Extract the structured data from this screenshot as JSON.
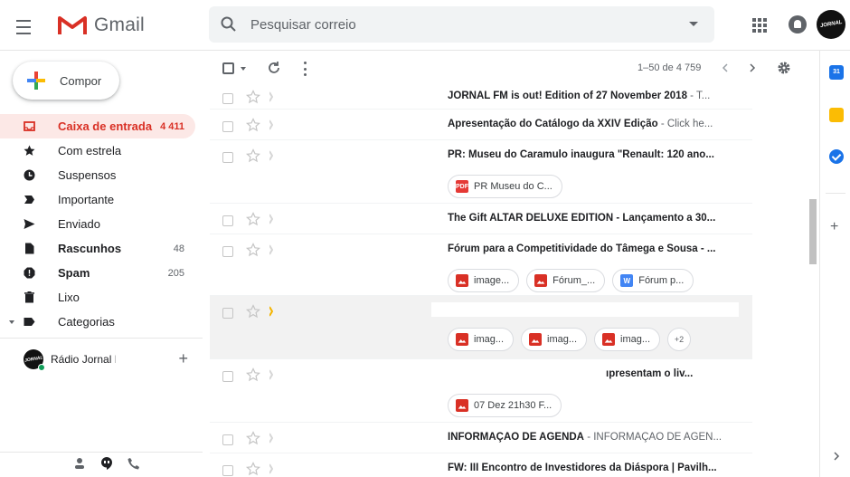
{
  "app": {
    "name": "Gmail",
    "colors": {
      "accent": "#d93025",
      "active_bg": "#fce8e6",
      "search_bg": "#f1f3f4",
      "selected_row": "#f2f2f2"
    }
  },
  "header": {
    "search_placeholder": "Pesquisar correio",
    "icons": [
      "menu-icon",
      "gmail-logo",
      "search-icon",
      "apps-grid-icon",
      "notifications-icon",
      "account-avatar"
    ],
    "avatar_text": "JORNAL"
  },
  "sidebar": {
    "compose_label": "Compor",
    "items": [
      {
        "label": "Caixa de entrada",
        "count": "4 411",
        "icon": "inbox-icon",
        "active": true,
        "bold": true
      },
      {
        "label": "Com estrela",
        "count": "",
        "icon": "star-icon",
        "active": false,
        "bold": false
      },
      {
        "label": "Suspensos",
        "count": "",
        "icon": "clock-icon",
        "active": false,
        "bold": false
      },
      {
        "label": "Importante",
        "count": "",
        "icon": "important-icon",
        "active": false,
        "bold": false
      },
      {
        "label": "Enviado",
        "count": "",
        "icon": "send-icon",
        "active": false,
        "bold": false
      },
      {
        "label": "Rascunhos",
        "count": "48",
        "icon": "draft-icon",
        "active": false,
        "bold": true
      },
      {
        "label": "Spam",
        "count": "205",
        "icon": "spam-icon",
        "active": false,
        "bold": true
      },
      {
        "label": "Lixo",
        "count": "",
        "icon": "trash-icon",
        "active": false,
        "bold": false
      },
      {
        "label": "Categorias",
        "count": "",
        "icon": "label-icon",
        "active": false,
        "bold": false
      }
    ],
    "hangout_name": "Rádio Jornal FM"
  },
  "toolbar": {
    "range": "1–50 de 4 759"
  },
  "messages": [
    {
      "subject": "JORNAL FM is out! Edition of 27 November 2018",
      "snippet": " - T...",
      "attachments": []
    },
    {
      "subject": "Apresentação do Catálogo da XXIV Edição",
      "snippet": " - Click he...",
      "attachments": []
    },
    {
      "subject": "PR: Museu do Caramulo inaugura \"Renault: 120 ano...",
      "snippet": "",
      "attachments": [
        {
          "name": "PR Museu do C...",
          "type": "pdf"
        }
      ]
    },
    {
      "subject": "The Gift ALTAR DELUXE EDITION - Lançamento a 30...",
      "snippet": "",
      "attachments": []
    },
    {
      "subject": "Fórum para a Competitividade do Tâmega e Sousa - ...",
      "snippet": "",
      "attachments": [
        {
          "name": "image...",
          "type": "img"
        },
        {
          "name": "Fórum_...",
          "type": "img"
        },
        {
          "name": "Fórum p...",
          "type": "word"
        }
      ]
    },
    {
      "subject": "",
      "snippet": "",
      "attachments": [
        {
          "name": "imag...",
          "type": "img"
        },
        {
          "name": "imag...",
          "type": "img"
        },
        {
          "name": "imag...",
          "type": "img"
        }
      ],
      "more": "+2"
    },
    {
      "subject": "ıpresentam o liv...",
      "snippet": "",
      "attachments": [
        {
          "name": "07 Dez 21h30 F...",
          "type": "img"
        }
      ]
    },
    {
      "subject": "INFORMAÇÃO DE AGENDA",
      "snippet": " - INFORMAÇÃO DE AGEN...",
      "attachments": []
    },
    {
      "subject": "FW: III Encontro de Investidores da Diáspora | Pavilh...",
      "snippet": "",
      "attachments": []
    }
  ],
  "addons": {
    "calendar_label": "31",
    "icons": [
      "calendar-icon",
      "keep-icon",
      "tasks-icon",
      "add-addon-icon",
      "expand-panel-icon"
    ]
  },
  "chip_labels": {
    "pdf": "PDF",
    "word": "W"
  }
}
